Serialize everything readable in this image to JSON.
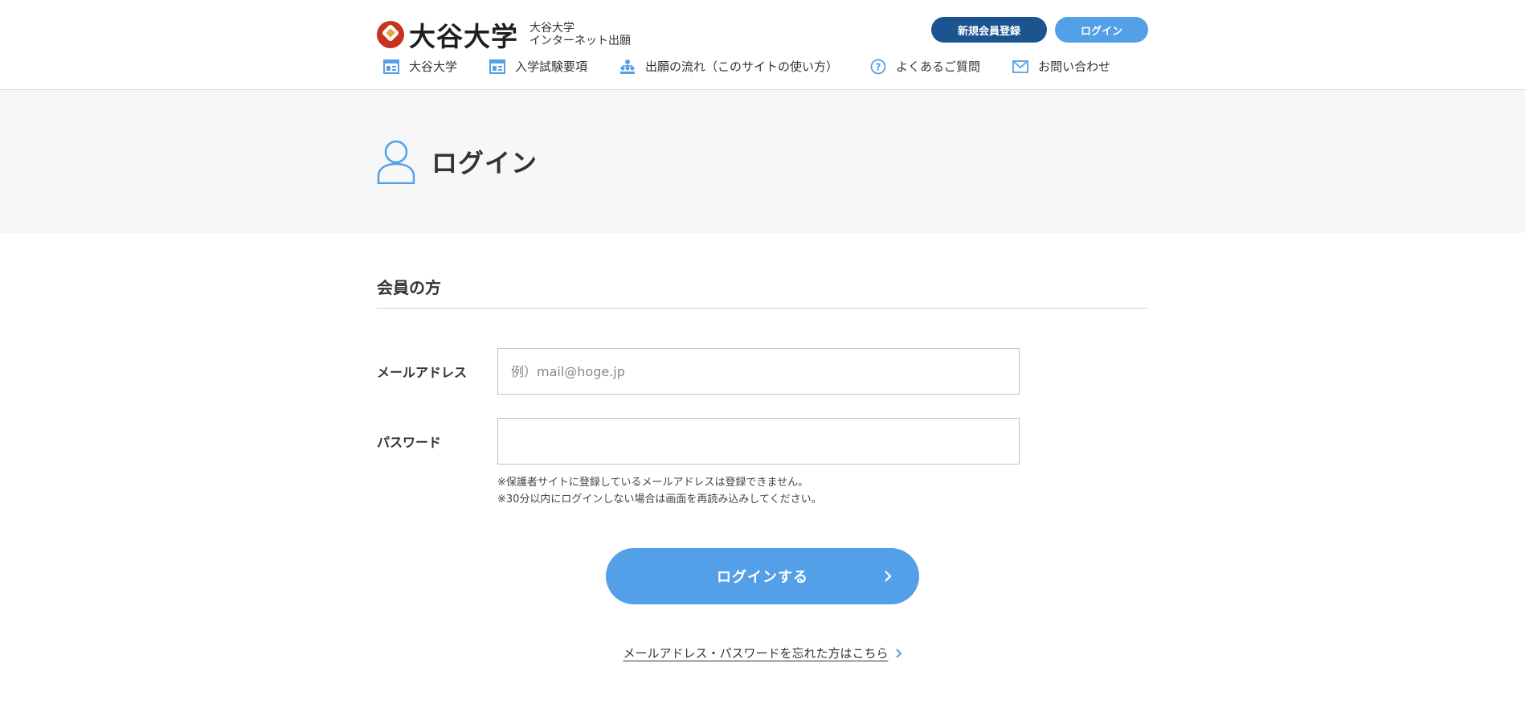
{
  "header": {
    "logo_name": "大谷大学",
    "logo_sub_line1": "大谷大学",
    "logo_sub_line2": "インターネット出願",
    "register_button": "新規会員登録",
    "login_button": "ログイン"
  },
  "nav": {
    "items": [
      {
        "label": "大谷大学",
        "icon": "page-icon"
      },
      {
        "label": "入学試験要項",
        "icon": "page-icon"
      },
      {
        "label": "出願の流れ（このサイトの使い方）",
        "icon": "flow-icon"
      },
      {
        "label": "よくあるご質問",
        "icon": "question-icon"
      },
      {
        "label": "お問い合わせ",
        "icon": "mail-icon"
      }
    ]
  },
  "page": {
    "title": "ログイン",
    "icon": "user-icon"
  },
  "form": {
    "section_title": "会員の方",
    "email_label": "メールアドレス",
    "email_placeholder": "例）mail@hoge.jp",
    "email_value": "",
    "password_label": "パスワード",
    "password_value": "",
    "note1": "※保護者サイトに登録しているメールアドレスは登録できません。",
    "note2": "※30分以内にログインしない場合は画面を再読み込みしてください。",
    "submit_label": "ログインする",
    "forgot_link": "メールアドレス・パスワードを忘れた方はこちら"
  },
  "colors": {
    "accent": "#54a0e8",
    "dark_blue": "#1c548f",
    "logo_red": "#c8331f"
  }
}
